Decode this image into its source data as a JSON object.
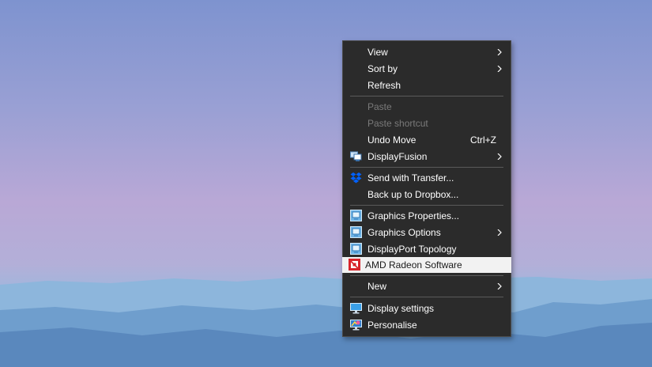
{
  "menu": {
    "view": "View",
    "sort_by": "Sort by",
    "refresh": "Refresh",
    "paste": "Paste",
    "paste_shortcut": "Paste shortcut",
    "undo_move": "Undo Move",
    "undo_shortcut": "Ctrl+Z",
    "displayfusion": "DisplayFusion",
    "send_with_transfer": "Send with Transfer...",
    "back_up_to_dropbox": "Back up to Dropbox...",
    "graphics_properties": "Graphics Properties...",
    "graphics_options": "Graphics Options",
    "displayport_topology": "DisplayPort Topology",
    "amd_radeon_software": "AMD Radeon Software",
    "new": "New",
    "display_settings": "Display settings",
    "personalise": "Personalise"
  },
  "icons": {
    "displayfusion": "displayfusion-icon",
    "dropbox": "dropbox-icon",
    "intel_graphics": "intel-graphics-icon",
    "amd": "amd-radeon-icon",
    "display": "display-settings-icon",
    "personalise": "personalise-icon"
  },
  "colors": {
    "menu_bg": "#2b2b2b",
    "highlight_bg": "#f2f2f2",
    "disabled_text": "#7a7a7a",
    "dropbox_blue": "#0061fe",
    "amd_red": "#d8232a"
  }
}
